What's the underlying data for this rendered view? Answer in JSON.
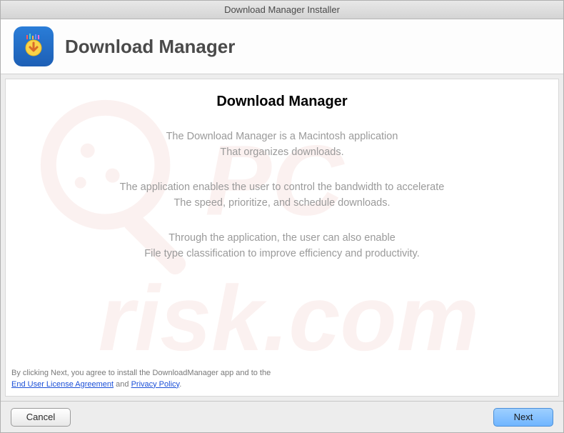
{
  "window": {
    "title": "Download Manager Installer"
  },
  "header": {
    "app_name": "Download Manager"
  },
  "content": {
    "heading": "Download Manager",
    "line1": "The Download Manager is a Macintosh application",
    "line2": "That organizes downloads.",
    "line3": "The application enables the user to control the bandwidth to accelerate",
    "line4": "The speed, prioritize, and schedule downloads.",
    "line5": "Through the application, the user can also enable",
    "line6": "File type classification to improve efficiency and productivity."
  },
  "agreement": {
    "prefix": "By clicking Next, you agree to install the DownloadManager app and to the",
    "eula_label": "End User License Agreement",
    "and": " and ",
    "privacy_label": "Privacy Policy",
    "suffix": "."
  },
  "footer": {
    "cancel_label": "Cancel",
    "next_label": "Next"
  },
  "watermark_text": "PCrisk.com"
}
